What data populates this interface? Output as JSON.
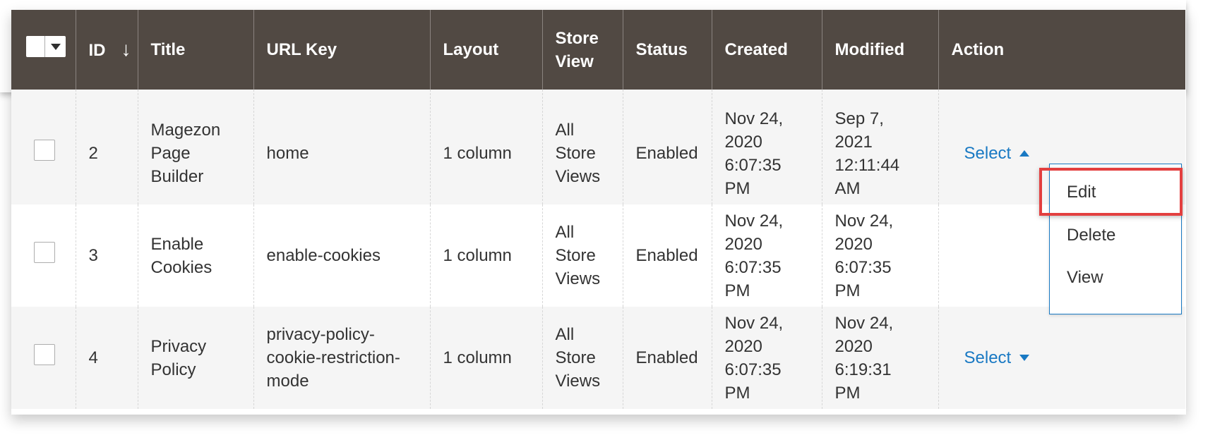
{
  "grid": {
    "headers": {
      "id": "ID",
      "sort_arrow": "↓",
      "title": "Title",
      "url_key": "URL Key",
      "layout": "Layout",
      "store_view": "Store View",
      "status": "Status",
      "created": "Created",
      "modified": "Modified",
      "action": "Action"
    },
    "rows": [
      {
        "id": "2",
        "title": "Magezon Page Builder",
        "url_key": "home",
        "layout": "1 column",
        "store_view": "All Store Views",
        "status": "Enabled",
        "created": "Nov 24, 2020 6:07:35 PM",
        "modified": "Sep 7, 2021 12:11:44 AM",
        "action": "Select",
        "action_open": true
      },
      {
        "id": "3",
        "title": "Enable Cookies",
        "url_key": "enable-cookies",
        "layout": "1 column",
        "store_view": "All Store Views",
        "status": "Enabled",
        "created": "Nov 24, 2020 6:07:35 PM",
        "modified": "Nov 24, 2020 6:07:35 PM",
        "action": ""
      },
      {
        "id": "4",
        "title": "Privacy Policy",
        "url_key": "privacy-policy-cookie-restriction-mode",
        "layout": "1 column",
        "store_view": "All Store Views",
        "status": "Enabled",
        "created": "Nov 24, 2020 6:07:35 PM",
        "modified": "Nov 24, 2020 6:19:31 PM",
        "action": "Select",
        "action_open": false
      }
    ]
  },
  "action_menu": {
    "items": [
      "Edit",
      "Delete",
      "View"
    ],
    "highlighted": "Edit"
  },
  "colors": {
    "header_bg": "#514943",
    "link": "#1979c3",
    "highlight": "#e33f3f"
  },
  "icons": {
    "sort": "arrow-down-icon",
    "mass_select": "chevron-down-icon",
    "select_open": "triangle-up-icon",
    "select_closed": "triangle-down-icon"
  }
}
